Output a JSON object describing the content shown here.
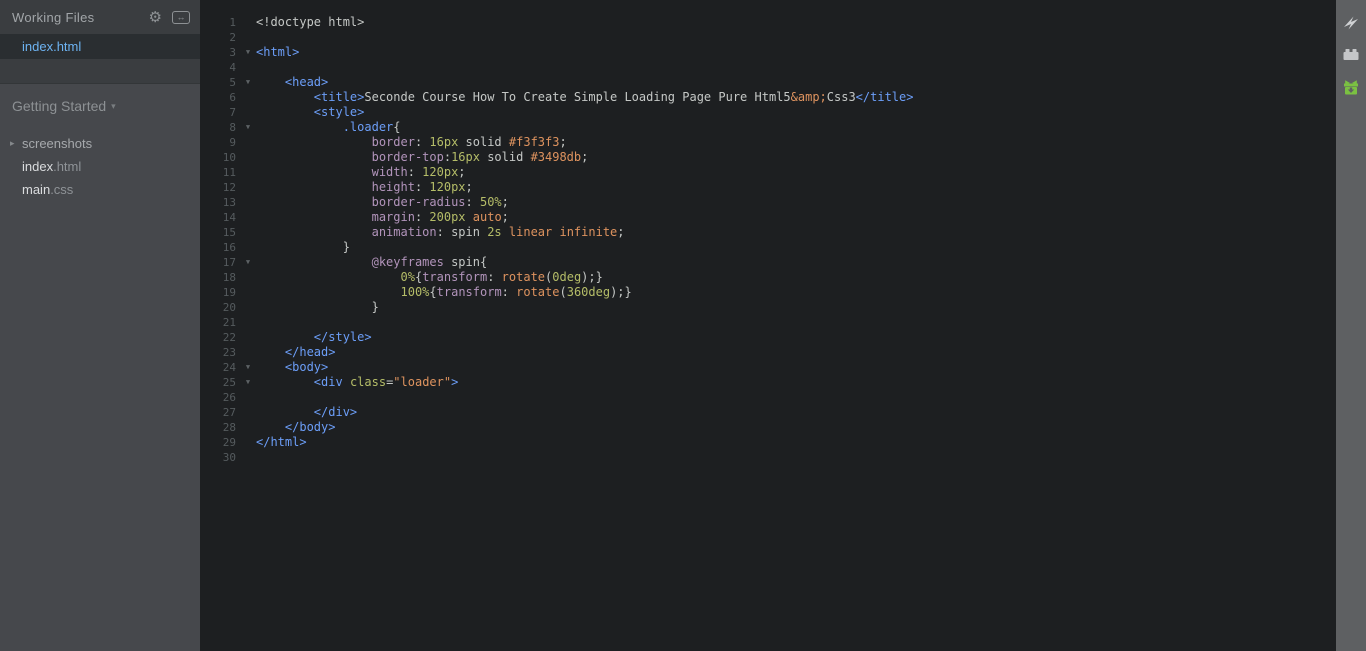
{
  "sidebar": {
    "working_files": {
      "title": "Working Files",
      "icons": [
        {
          "name": "gear-icon",
          "glyph": "⚙"
        },
        {
          "name": "split-view-icon",
          "glyph": "↔"
        }
      ],
      "files": [
        {
          "name": "index.html",
          "selected": true
        }
      ]
    },
    "project": {
      "title": "Getting Started",
      "caret": "▾",
      "tree": [
        {
          "type": "folder",
          "label": "screenshots",
          "tri": "▸"
        },
        {
          "type": "file",
          "base": "index",
          "ext": ".html"
        },
        {
          "type": "file",
          "base": "main",
          "ext": ".css"
        }
      ]
    }
  },
  "toolbar": {
    "icons": [
      {
        "name": "live-preview-icon"
      },
      {
        "name": "extension-manager-icon"
      },
      {
        "name": "extension-update-icon"
      }
    ],
    "colors": {
      "icon_grey": "#cfd1d3",
      "gift_green": "#7bc142"
    }
  },
  "editor": {
    "total_lines": 30,
    "token_colors": {
      "default": "#c5c8c6",
      "tag": "#6c9ef8",
      "property": "#b294bb",
      "number": "#b5bd68",
      "keyword": "#de935f"
    },
    "lines": [
      {
        "n": 1,
        "fold": false,
        "seg": [
          [
            "d",
            "<!doctype html>"
          ]
        ]
      },
      {
        "n": 2,
        "fold": false,
        "seg": []
      },
      {
        "n": 3,
        "fold": true,
        "seg": [
          [
            "t",
            "<html>"
          ]
        ]
      },
      {
        "n": 4,
        "fold": false,
        "seg": []
      },
      {
        "n": 5,
        "fold": true,
        "seg": [
          [
            "d",
            "    "
          ],
          [
            "t",
            "<head>"
          ]
        ]
      },
      {
        "n": 6,
        "fold": false,
        "seg": [
          [
            "d",
            "        "
          ],
          [
            "t",
            "<title>"
          ],
          [
            "d",
            "Seconde Course How To Create Simple Loading Page Pure Html5"
          ],
          [
            "o",
            "&amp;"
          ],
          [
            "d",
            "Css3"
          ],
          [
            "t",
            "</title>"
          ]
        ]
      },
      {
        "n": 7,
        "fold": false,
        "seg": [
          [
            "d",
            "        "
          ],
          [
            "t",
            "<style>"
          ]
        ]
      },
      {
        "n": 8,
        "fold": true,
        "seg": [
          [
            "d",
            "            "
          ],
          [
            "t",
            ".loader"
          ],
          [
            "d",
            "{"
          ]
        ]
      },
      {
        "n": 9,
        "fold": false,
        "seg": [
          [
            "d",
            "                "
          ],
          [
            "p",
            "border"
          ],
          [
            "d",
            ": "
          ],
          [
            "n",
            "16px"
          ],
          [
            "d",
            " solid "
          ],
          [
            "o",
            "#f3f3f3"
          ],
          [
            "d",
            ";"
          ]
        ]
      },
      {
        "n": 10,
        "fold": false,
        "seg": [
          [
            "d",
            "                "
          ],
          [
            "p",
            "border-top"
          ],
          [
            "d",
            ":"
          ],
          [
            "n",
            "16px"
          ],
          [
            "d",
            " solid "
          ],
          [
            "o",
            "#3498db"
          ],
          [
            "d",
            ";"
          ]
        ]
      },
      {
        "n": 11,
        "fold": false,
        "seg": [
          [
            "d",
            "                "
          ],
          [
            "p",
            "width"
          ],
          [
            "d",
            ": "
          ],
          [
            "n",
            "120px"
          ],
          [
            "d",
            ";"
          ]
        ]
      },
      {
        "n": 12,
        "fold": false,
        "seg": [
          [
            "d",
            "                "
          ],
          [
            "p",
            "height"
          ],
          [
            "d",
            ": "
          ],
          [
            "n",
            "120px"
          ],
          [
            "d",
            ";"
          ]
        ]
      },
      {
        "n": 13,
        "fold": false,
        "seg": [
          [
            "d",
            "                "
          ],
          [
            "p",
            "border-radius"
          ],
          [
            "d",
            ": "
          ],
          [
            "n",
            "50%"
          ],
          [
            "d",
            ";"
          ]
        ]
      },
      {
        "n": 14,
        "fold": false,
        "seg": [
          [
            "d",
            "                "
          ],
          [
            "p",
            "margin"
          ],
          [
            "d",
            ": "
          ],
          [
            "n",
            "200px"
          ],
          [
            "d",
            " "
          ],
          [
            "o",
            "auto"
          ],
          [
            "d",
            ";"
          ]
        ]
      },
      {
        "n": 15,
        "fold": false,
        "seg": [
          [
            "d",
            "                "
          ],
          [
            "p",
            "animation"
          ],
          [
            "d",
            ": spin "
          ],
          [
            "n",
            "2s"
          ],
          [
            "d",
            " "
          ],
          [
            "o",
            "linear"
          ],
          [
            "d",
            " "
          ],
          [
            "o",
            "infinite"
          ],
          [
            "d",
            ";"
          ]
        ]
      },
      {
        "n": 16,
        "fold": false,
        "seg": [
          [
            "d",
            "            }"
          ]
        ]
      },
      {
        "n": 17,
        "fold": true,
        "seg": [
          [
            "d",
            "                "
          ],
          [
            "p",
            "@keyframes"
          ],
          [
            "d",
            " spin{"
          ]
        ]
      },
      {
        "n": 18,
        "fold": false,
        "seg": [
          [
            "d",
            "                    "
          ],
          [
            "n",
            "0%"
          ],
          [
            "d",
            "{"
          ],
          [
            "p",
            "transform"
          ],
          [
            "d",
            ": "
          ],
          [
            "o",
            "rotate"
          ],
          [
            "d",
            "("
          ],
          [
            "n",
            "0deg"
          ],
          [
            "d",
            ");}"
          ]
        ]
      },
      {
        "n": 19,
        "fold": false,
        "seg": [
          [
            "d",
            "                    "
          ],
          [
            "n",
            "100%"
          ],
          [
            "d",
            "{"
          ],
          [
            "p",
            "transform"
          ],
          [
            "d",
            ": "
          ],
          [
            "o",
            "rotate"
          ],
          [
            "d",
            "("
          ],
          [
            "n",
            "360deg"
          ],
          [
            "d",
            ");}"
          ]
        ]
      },
      {
        "n": 20,
        "fold": false,
        "seg": [
          [
            "d",
            "                }"
          ]
        ]
      },
      {
        "n": 21,
        "fold": false,
        "seg": []
      },
      {
        "n": 22,
        "fold": false,
        "seg": [
          [
            "d",
            "        "
          ],
          [
            "t",
            "</style>"
          ]
        ]
      },
      {
        "n": 23,
        "fold": false,
        "seg": [
          [
            "d",
            "    "
          ],
          [
            "t",
            "</head>"
          ]
        ]
      },
      {
        "n": 24,
        "fold": true,
        "seg": [
          [
            "d",
            "    "
          ],
          [
            "t",
            "<body>"
          ]
        ]
      },
      {
        "n": 25,
        "fold": true,
        "seg": [
          [
            "d",
            "        "
          ],
          [
            "t",
            "<div"
          ],
          [
            "d",
            " "
          ],
          [
            "n",
            "class"
          ],
          [
            "d",
            "="
          ],
          [
            "o",
            "\"loader\""
          ],
          [
            "t",
            ">"
          ]
        ]
      },
      {
        "n": 26,
        "fold": false,
        "seg": []
      },
      {
        "n": 27,
        "fold": false,
        "seg": [
          [
            "d",
            "        "
          ],
          [
            "t",
            "</div>"
          ]
        ]
      },
      {
        "n": 28,
        "fold": false,
        "seg": [
          [
            "d",
            "    "
          ],
          [
            "t",
            "</body>"
          ]
        ]
      },
      {
        "n": 29,
        "fold": false,
        "seg": [
          [
            "t",
            "</html>"
          ]
        ]
      },
      {
        "n": 30,
        "fold": false,
        "seg": []
      }
    ]
  }
}
